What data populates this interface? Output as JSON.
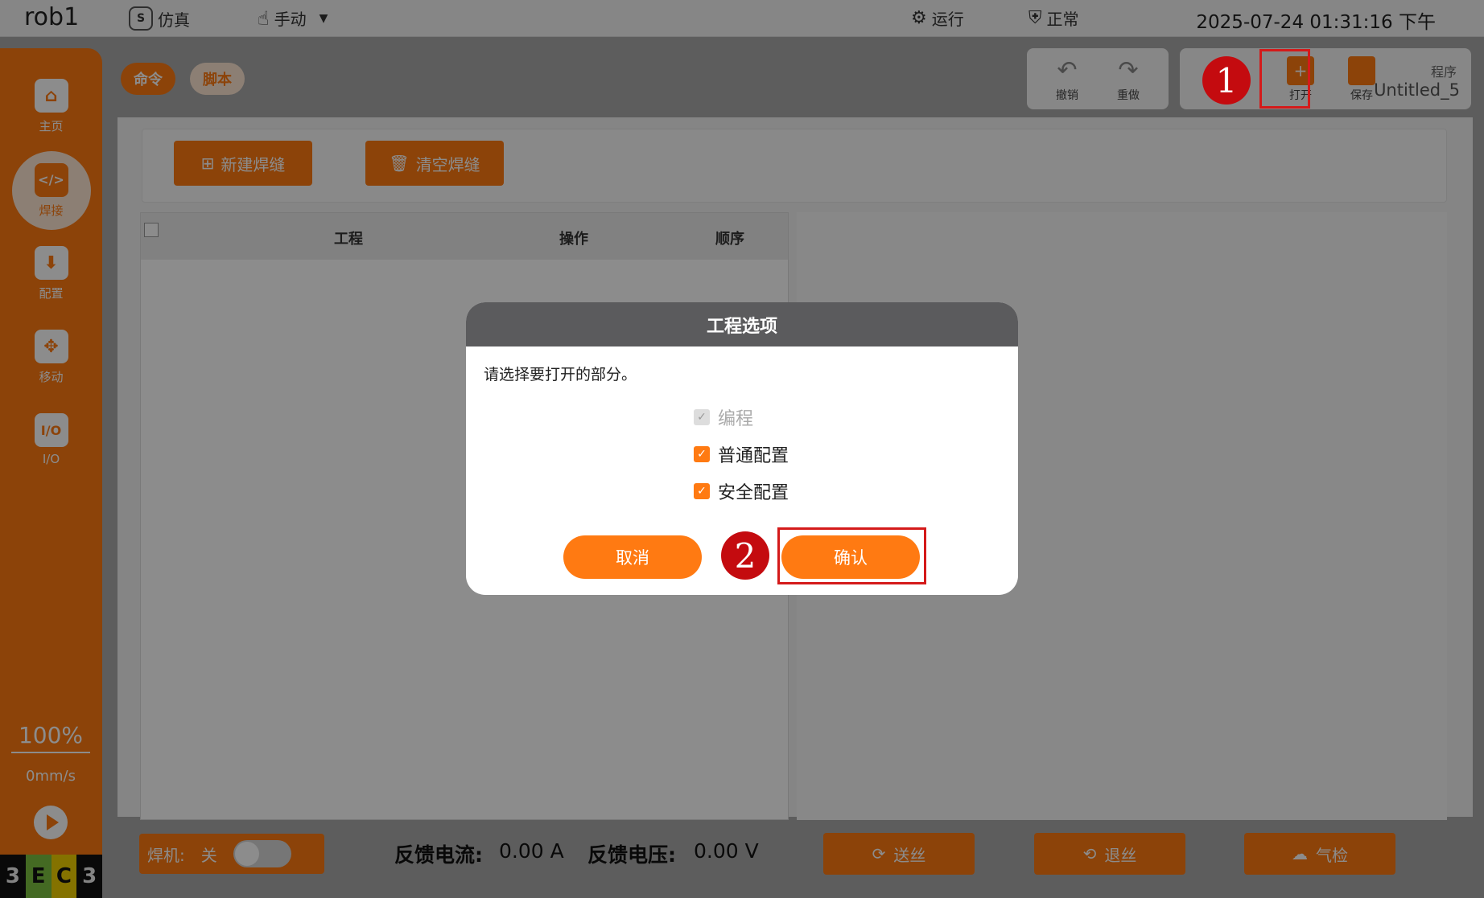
{
  "topbar": {
    "robot": "rob1",
    "sim_label": "仿真",
    "mode_label": "手动",
    "run_label": "运行",
    "status_label": "正常",
    "datetime": "2025-07-24 01:31:16 下午"
  },
  "sidebar": {
    "items": [
      {
        "label": "主页",
        "icon": "home-icon"
      },
      {
        "label": "焊接",
        "icon": "code-icon"
      },
      {
        "label": "配置",
        "icon": "download-icon"
      },
      {
        "label": "移动",
        "icon": "move-icon"
      },
      {
        "label": "I/O",
        "icon": "io-icon"
      }
    ],
    "speed_pct": "100%",
    "speed_mm": "0mm/s",
    "logo": [
      "3",
      "E",
      "C",
      "3"
    ]
  },
  "tabs": {
    "command": "命令",
    "script": "脚本"
  },
  "toolbar": {
    "undo": "撤销",
    "redo": "重做",
    "open": "打开",
    "save": "保存",
    "program_label": "程序",
    "program_name": "Untitled_5"
  },
  "actions": {
    "new_weld": "新建焊缝",
    "clear_weld": "清空焊缝"
  },
  "table": {
    "columns": [
      "工程",
      "操作",
      "顺序"
    ]
  },
  "bottom": {
    "welder_label": "焊机:",
    "welder_state": "关",
    "current_label": "反馈电流:",
    "current_value": "0.00 A",
    "voltage_label": "反馈电压:",
    "voltage_value": "0.00 V",
    "feed": "送丝",
    "retract": "退丝",
    "gas": "气检"
  },
  "modal": {
    "title": "工程选项",
    "message": "请选择要打开的部分。",
    "options": [
      {
        "label": "编程",
        "checked": true,
        "disabled": true
      },
      {
        "label": "普通配置",
        "checked": true,
        "disabled": false
      },
      {
        "label": "安全配置",
        "checked": true,
        "disabled": false
      }
    ],
    "cancel": "取消",
    "confirm": "确认"
  },
  "annotations": {
    "marker1": "1",
    "marker2": "2"
  },
  "colors": {
    "accent": "#ff7a12",
    "marker": "#c40b0f",
    "modal_header": "#5b5b5d"
  }
}
